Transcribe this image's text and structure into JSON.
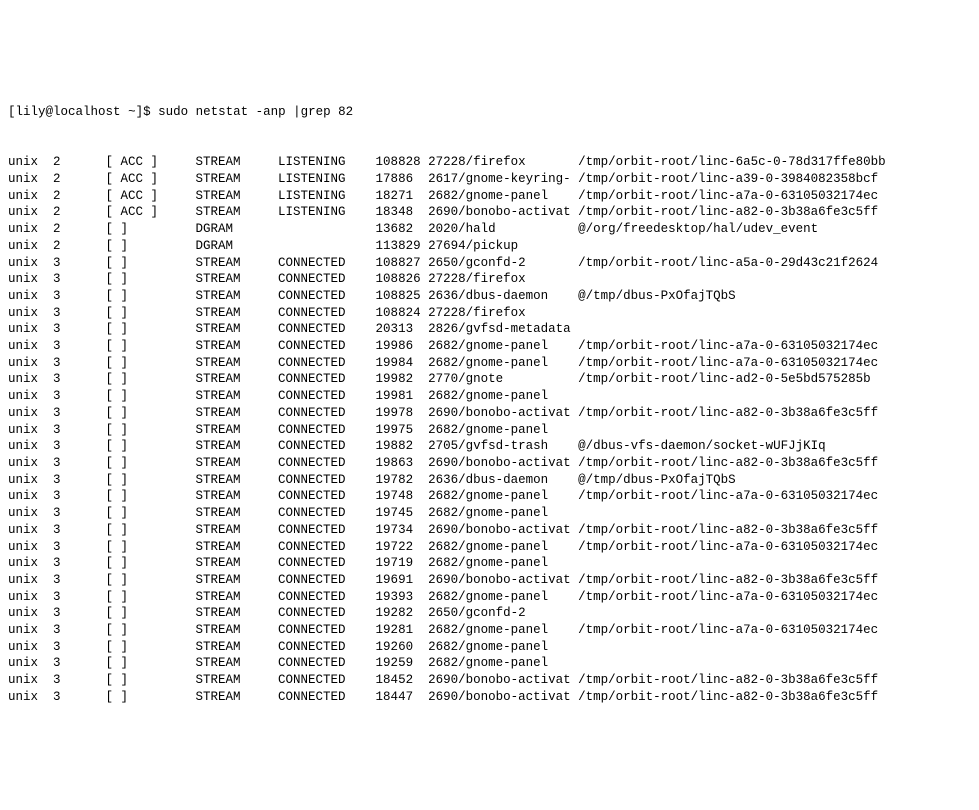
{
  "prompt": {
    "userHost": "lily@localhost",
    "dir": "~",
    "dollar": "$",
    "bracketOpen": "[",
    "bracketClose": "]"
  },
  "command": "sudo netstat -anp |grep 82",
  "rows": [
    {
      "proto": "unix",
      "refcnt": "2",
      "flags": "[ ACC ]",
      "type": "STREAM",
      "state": "LISTENING",
      "inode": "108828",
      "pid": "27228/firefox",
      "path": "/tmp/orbit-root/linc-6a5c-0-78d317ffe80bb"
    },
    {
      "proto": "unix",
      "refcnt": "2",
      "flags": "[ ACC ]",
      "type": "STREAM",
      "state": "LISTENING",
      "inode": "17886",
      "pid": "2617/gnome-keyring-",
      "path": "/tmp/orbit-root/linc-a39-0-3984082358bcf"
    },
    {
      "proto": "unix",
      "refcnt": "2",
      "flags": "[ ACC ]",
      "type": "STREAM",
      "state": "LISTENING",
      "inode": "18271",
      "pid": "2682/gnome-panel",
      "path": "/tmp/orbit-root/linc-a7a-0-63105032174ec"
    },
    {
      "proto": "unix",
      "refcnt": "2",
      "flags": "[ ACC ]",
      "type": "STREAM",
      "state": "LISTENING",
      "inode": "18348",
      "pid": "2690/bonobo-activat",
      "path": "/tmp/orbit-root/linc-a82-0-3b38a6fe3c5ff"
    },
    {
      "proto": "unix",
      "refcnt": "2",
      "flags": "[ ]",
      "type": "DGRAM",
      "state": "",
      "inode": "13682",
      "pid": "2020/hald",
      "path": "@/org/freedesktop/hal/udev_event"
    },
    {
      "proto": "unix",
      "refcnt": "2",
      "flags": "[ ]",
      "type": "DGRAM",
      "state": "",
      "inode": "113829",
      "pid": "27694/pickup",
      "path": ""
    },
    {
      "proto": "unix",
      "refcnt": "3",
      "flags": "[ ]",
      "type": "STREAM",
      "state": "CONNECTED",
      "inode": "108827",
      "pid": "2650/gconfd-2",
      "path": "/tmp/orbit-root/linc-a5a-0-29d43c21f2624"
    },
    {
      "proto": "unix",
      "refcnt": "3",
      "flags": "[ ]",
      "type": "STREAM",
      "state": "CONNECTED",
      "inode": "108826",
      "pid": "27228/firefox",
      "path": ""
    },
    {
      "proto": "unix",
      "refcnt": "3",
      "flags": "[ ]",
      "type": "STREAM",
      "state": "CONNECTED",
      "inode": "108825",
      "pid": "2636/dbus-daemon",
      "path": "@/tmp/dbus-PxOfajTQbS"
    },
    {
      "proto": "unix",
      "refcnt": "3",
      "flags": "[ ]",
      "type": "STREAM",
      "state": "CONNECTED",
      "inode": "108824",
      "pid": "27228/firefox",
      "path": ""
    },
    {
      "proto": "unix",
      "refcnt": "3",
      "flags": "[ ]",
      "type": "STREAM",
      "state": "CONNECTED",
      "inode": "20313",
      "pid": "2826/gvfsd-metadata",
      "path": ""
    },
    {
      "proto": "unix",
      "refcnt": "3",
      "flags": "[ ]",
      "type": "STREAM",
      "state": "CONNECTED",
      "inode": "19986",
      "pid": "2682/gnome-panel",
      "path": "/tmp/orbit-root/linc-a7a-0-63105032174ec"
    },
    {
      "proto": "unix",
      "refcnt": "3",
      "flags": "[ ]",
      "type": "STREAM",
      "state": "CONNECTED",
      "inode": "19984",
      "pid": "2682/gnome-panel",
      "path": "/tmp/orbit-root/linc-a7a-0-63105032174ec"
    },
    {
      "proto": "unix",
      "refcnt": "3",
      "flags": "[ ]",
      "type": "STREAM",
      "state": "CONNECTED",
      "inode": "19982",
      "pid": "2770/gnote",
      "path": "/tmp/orbit-root/linc-ad2-0-5e5bd575285b"
    },
    {
      "proto": "unix",
      "refcnt": "3",
      "flags": "[ ]",
      "type": "STREAM",
      "state": "CONNECTED",
      "inode": "19981",
      "pid": "2682/gnome-panel",
      "path": ""
    },
    {
      "proto": "unix",
      "refcnt": "3",
      "flags": "[ ]",
      "type": "STREAM",
      "state": "CONNECTED",
      "inode": "19978",
      "pid": "2690/bonobo-activat",
      "path": "/tmp/orbit-root/linc-a82-0-3b38a6fe3c5ff"
    },
    {
      "proto": "unix",
      "refcnt": "3",
      "flags": "[ ]",
      "type": "STREAM",
      "state": "CONNECTED",
      "inode": "19975",
      "pid": "2682/gnome-panel",
      "path": ""
    },
    {
      "proto": "unix",
      "refcnt": "3",
      "flags": "[ ]",
      "type": "STREAM",
      "state": "CONNECTED",
      "inode": "19882",
      "pid": "2705/gvfsd-trash",
      "path": "@/dbus-vfs-daemon/socket-wUFJjKIq"
    },
    {
      "proto": "unix",
      "refcnt": "3",
      "flags": "[ ]",
      "type": "STREAM",
      "state": "CONNECTED",
      "inode": "19863",
      "pid": "2690/bonobo-activat",
      "path": "/tmp/orbit-root/linc-a82-0-3b38a6fe3c5ff"
    },
    {
      "proto": "unix",
      "refcnt": "3",
      "flags": "[ ]",
      "type": "STREAM",
      "state": "CONNECTED",
      "inode": "19782",
      "pid": "2636/dbus-daemon",
      "path": "@/tmp/dbus-PxOfajTQbS"
    },
    {
      "proto": "unix",
      "refcnt": "3",
      "flags": "[ ]",
      "type": "STREAM",
      "state": "CONNECTED",
      "inode": "19748",
      "pid": "2682/gnome-panel",
      "path": "/tmp/orbit-root/linc-a7a-0-63105032174ec"
    },
    {
      "proto": "unix",
      "refcnt": "3",
      "flags": "[ ]",
      "type": "STREAM",
      "state": "CONNECTED",
      "inode": "19745",
      "pid": "2682/gnome-panel",
      "path": ""
    },
    {
      "proto": "unix",
      "refcnt": "3",
      "flags": "[ ]",
      "type": "STREAM",
      "state": "CONNECTED",
      "inode": "19734",
      "pid": "2690/bonobo-activat",
      "path": "/tmp/orbit-root/linc-a82-0-3b38a6fe3c5ff"
    },
    {
      "proto": "unix",
      "refcnt": "3",
      "flags": "[ ]",
      "type": "STREAM",
      "state": "CONNECTED",
      "inode": "19722",
      "pid": "2682/gnome-panel",
      "path": "/tmp/orbit-root/linc-a7a-0-63105032174ec"
    },
    {
      "proto": "unix",
      "refcnt": "3",
      "flags": "[ ]",
      "type": "STREAM",
      "state": "CONNECTED",
      "inode": "19719",
      "pid": "2682/gnome-panel",
      "path": ""
    },
    {
      "proto": "unix",
      "refcnt": "3",
      "flags": "[ ]",
      "type": "STREAM",
      "state": "CONNECTED",
      "inode": "19691",
      "pid": "2690/bonobo-activat",
      "path": "/tmp/orbit-root/linc-a82-0-3b38a6fe3c5ff"
    },
    {
      "proto": "unix",
      "refcnt": "3",
      "flags": "[ ]",
      "type": "STREAM",
      "state": "CONNECTED",
      "inode": "19393",
      "pid": "2682/gnome-panel",
      "path": "/tmp/orbit-root/linc-a7a-0-63105032174ec"
    },
    {
      "proto": "unix",
      "refcnt": "3",
      "flags": "[ ]",
      "type": "STREAM",
      "state": "CONNECTED",
      "inode": "19282",
      "pid": "2650/gconfd-2",
      "path": ""
    },
    {
      "proto": "unix",
      "refcnt": "3",
      "flags": "[ ]",
      "type": "STREAM",
      "state": "CONNECTED",
      "inode": "19281",
      "pid": "2682/gnome-panel",
      "path": "/tmp/orbit-root/linc-a7a-0-63105032174ec"
    },
    {
      "proto": "unix",
      "refcnt": "3",
      "flags": "[ ]",
      "type": "STREAM",
      "state": "CONNECTED",
      "inode": "19260",
      "pid": "2682/gnome-panel",
      "path": ""
    },
    {
      "proto": "unix",
      "refcnt": "3",
      "flags": "[ ]",
      "type": "STREAM",
      "state": "CONNECTED",
      "inode": "19259",
      "pid": "2682/gnome-panel",
      "path": ""
    },
    {
      "proto": "unix",
      "refcnt": "3",
      "flags": "[ ]",
      "type": "STREAM",
      "state": "CONNECTED",
      "inode": "18452",
      "pid": "2690/bonobo-activat",
      "path": "/tmp/orbit-root/linc-a82-0-3b38a6fe3c5ff"
    },
    {
      "proto": "unix",
      "refcnt": "3",
      "flags": "[ ]",
      "type": "STREAM",
      "state": "CONNECTED",
      "inode": "18447",
      "pid": "2690/bonobo-activat",
      "path": "/tmp/orbit-root/linc-a82-0-3b38a6fe3c5ff"
    }
  ]
}
